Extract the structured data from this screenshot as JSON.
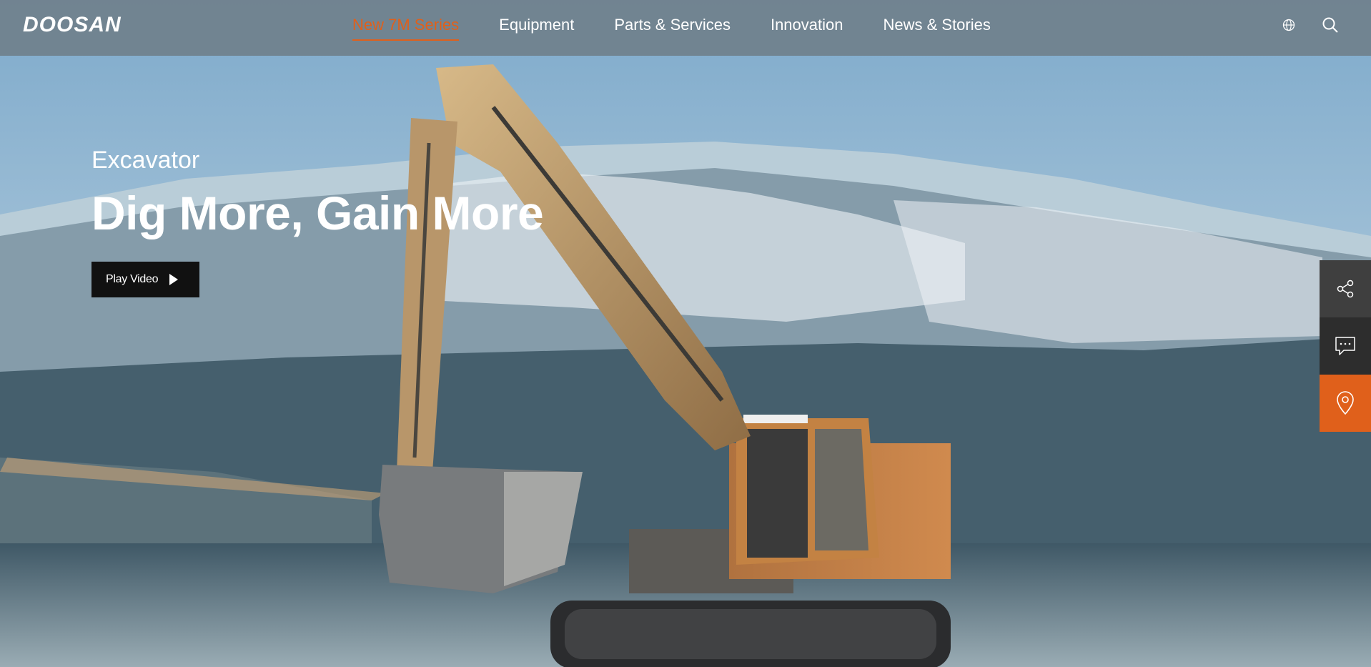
{
  "header": {
    "logo": "DOOSAN",
    "nav": [
      {
        "label": "New 7M Series",
        "active": true
      },
      {
        "label": "Equipment",
        "active": false
      },
      {
        "label": "Parts & Services",
        "active": false
      },
      {
        "label": "Innovation",
        "active": false
      },
      {
        "label": "News & Stories",
        "active": false
      }
    ],
    "tools": [
      {
        "icon": "globe-icon"
      },
      {
        "icon": "search-icon"
      }
    ]
  },
  "hero": {
    "subtitle": "Excavator",
    "title": "Dig More, Gain More",
    "play_button_label": "Play Video",
    "play_icon": "play-icon"
  },
  "side_menu": [
    {
      "icon": "share-icon"
    },
    {
      "icon": "chat-icon"
    },
    {
      "icon": "location-pin-icon"
    }
  ],
  "colors": {
    "accent": "#e0601b",
    "header_bg": "#70808c",
    "button_bg": "#111111",
    "side_dark": "#3f3f3f"
  }
}
